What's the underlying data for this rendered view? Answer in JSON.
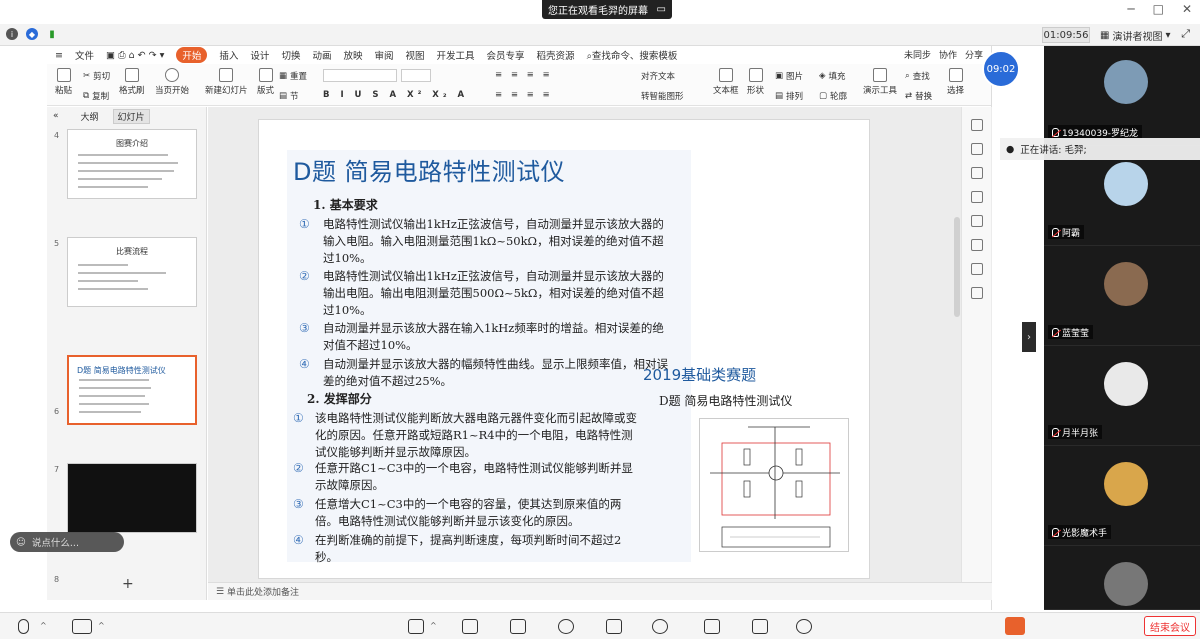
{
  "banner": {
    "text": "您正在观看毛羿的屏幕",
    "minimize_icon": "minimize-icon",
    "maximize_icon": "maximize-icon"
  },
  "window_controls": [
    "─",
    "□",
    "✕"
  ],
  "meeting": {
    "timer": "01:09:56",
    "view_mode": "演讲者视图",
    "clock_badge": "09:02"
  },
  "wps": {
    "file_menu": "文件",
    "menus": [
      "开始",
      "插入",
      "设计",
      "切换",
      "动画",
      "放映",
      "审阅",
      "视图",
      "开发工具",
      "会员专享",
      "稻壳资源"
    ],
    "active_menu": "开始",
    "search_placeholder": "查找命令、搜索模板",
    "right_actions": [
      "未同步",
      "协作",
      "分享"
    ],
    "ribbon": {
      "paste": "粘贴",
      "cut": "剪切",
      "copy": "复制",
      "format_painter": "格式刷",
      "start_from_current": "当页开始",
      "new_slide": "新建幻灯片",
      "layout": "版式",
      "section": "节",
      "reset": "重置",
      "text_box": "文本框",
      "shape": "形状",
      "arrange": "排列",
      "outline": "轮廓",
      "picture": "图片",
      "fill": "填充",
      "find": "查找",
      "replace": "替换",
      "presenter_tools": "演示工具",
      "select": "选择",
      "align_text": "对齐文本",
      "convert_smartart": "转智能图形"
    },
    "panel_tabs": [
      "大纲",
      "幻灯片"
    ],
    "active_panel_tab": "幻灯片",
    "thumbnails": [
      {
        "num": "4",
        "title": "图赛介绍"
      },
      {
        "num": "5",
        "title": "比赛流程"
      },
      {
        "num": "6",
        "title": "D题 简易电路特性测试仪"
      },
      {
        "num": "7",
        "title": ""
      },
      {
        "num": "8",
        "title": ""
      }
    ],
    "notes_placeholder": "单击此处添加备注"
  },
  "slide": {
    "title": "D题 简易电路特性测试仪",
    "section1": "1. 基本要求",
    "basic": [
      {
        "num": "①",
        "text": "电路特性测试仪输出1kHz正弦波信号，自动测量并显示该放大器的输入电阻。输入电阻测量范围1kΩ~50kΩ，相对误差的绝对值不超过10%。"
      },
      {
        "num": "②",
        "text": "电路特性测试仪输出1kHz正弦波信号，自动测量并显示该放大器的输出电阻。输出电阻测量范围500Ω~5kΩ，相对误差的绝对值不超过10%。"
      },
      {
        "num": "③",
        "text": "自动测量并显示该放大器在输入1kHz频率时的增益。相对误差的绝对值不超过10%。"
      },
      {
        "num": "④",
        "text": "自动测量并显示该放大器的幅频特性曲线。显示上限频率值，相对误差的绝对值不超过25%。"
      }
    ],
    "section2": "2. 发挥部分",
    "advanced": [
      {
        "num": "①",
        "text": "该电路特性测试仪能判断放大器电路元器件变化而引起故障或变化的原因。任意开路或短路R1~R4中的一个电阻，电路特性测试仪能够判断并显示故障原因。"
      },
      {
        "num": "②",
        "text": "任意开路C1~C3中的一个电容，电路特性测试仪能够判断并显示故障原因。"
      },
      {
        "num": "③",
        "text": "任意增大C1~C3中的一个电容的容量，使其达到原来值的两倍。电路特性测试仪能够判断并显示该变化的原因。"
      },
      {
        "num": "④",
        "text": "在判断准确的前提下，提高判断速度，每项判断时间不超过2秒。"
      }
    ],
    "year_title": "2019基础类赛题",
    "year_subtitle": "D题 简易电路特性测试仪"
  },
  "participants": [
    {
      "name": "19340039-罗纪龙",
      "color": "#7d9bb5"
    },
    {
      "name": "阿霸",
      "color": "#b8d4ea"
    },
    {
      "name": "蓝莹莹",
      "color": "#8a6a50"
    },
    {
      "name": "月半月张",
      "color": "#e9e9e9"
    },
    {
      "name": "光影魔术手",
      "color": "#d9a64b"
    },
    {
      "name": "",
      "color": "#777777"
    }
  ],
  "speaking": {
    "label": "正在讲话: 毛羿;"
  },
  "chat": {
    "placeholder": "说点什么..."
  },
  "toolbar": {
    "end": "结束会议"
  }
}
